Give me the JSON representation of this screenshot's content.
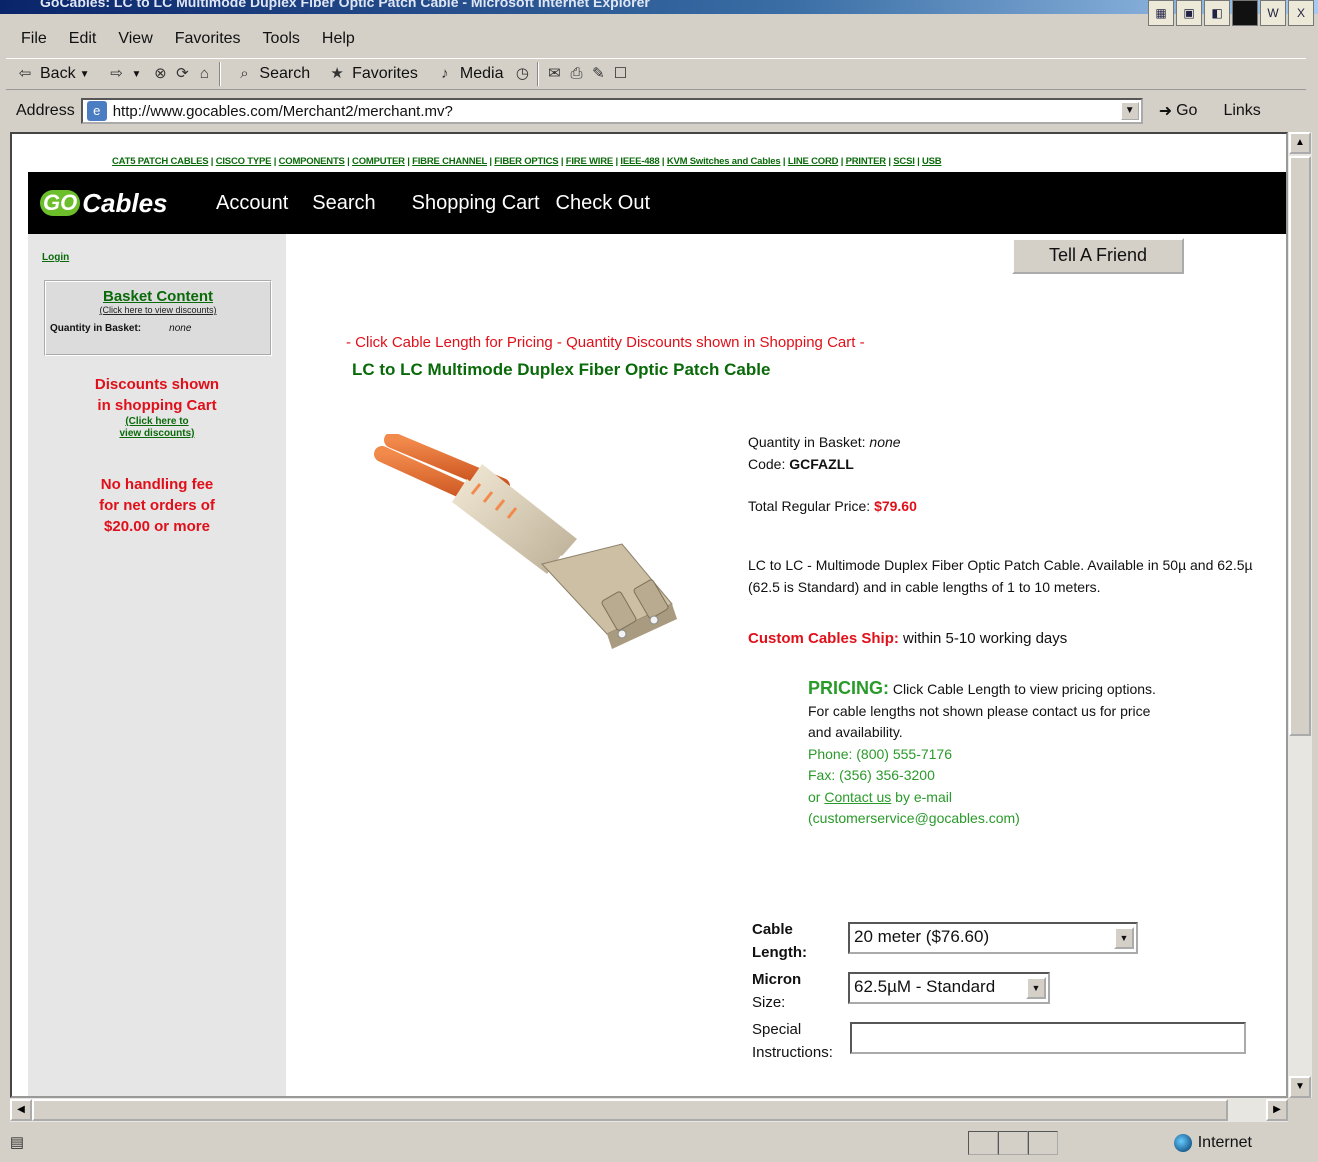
{
  "window": {
    "title": "GoCables: LC to LC Multimode Duplex Fiber Optic Patch Cable - Microsoft Internet Explorer"
  },
  "menu": [
    "File",
    "Edit",
    "View",
    "Favorites",
    "Tools",
    "Help"
  ],
  "toolbar": {
    "back": "Back",
    "search": "Search",
    "favorites": "Favorites",
    "media": "Media"
  },
  "address": {
    "label": "Address",
    "url": "http://www.gocables.com/Merchant2/merchant.mv?",
    "go": "Go",
    "links": "Links"
  },
  "status": {
    "zone": "Internet"
  },
  "site": {
    "categories": [
      "CAT5 PATCH CABLES",
      "CISCO TYPE",
      "COMPONENTS",
      "COMPUTER",
      "FIBRE CHANNEL",
      "FIBER OPTICS",
      "FIRE WIRE",
      "IEEE-488",
      "KVM Switches and Cables",
      "LINE CORD",
      "PRINTER",
      "SCSI",
      "USB"
    ],
    "logo": {
      "go": "GO",
      "rest": "Cables"
    },
    "nav": [
      "Account",
      "Search",
      "Shopping Cart",
      "Check Out"
    ]
  },
  "sidebar": {
    "login": "Login",
    "basket_title": "Basket Content",
    "basket_sub": "(Click here to view discounts)",
    "qty_label": "Quantity in Basket:",
    "qty_value": "none",
    "discount_line1": "Discounts shown",
    "discount_line2": "in shopping Cart",
    "discount_link1": "(Click here to",
    "discount_link2": "view discounts)",
    "fee_line1": "No handling fee",
    "fee_line2": "for net orders of",
    "fee_line3": "$20.00 or more"
  },
  "main": {
    "tell_friend": "Tell A Friend",
    "promo": "- Click Cable Length for Pricing - Quantity Discounts shown in Shopping Cart -",
    "title": "LC to LC Multimode Duplex Fiber Optic Patch Cable",
    "qty_label": "Quantity in Basket:",
    "qty_value": "none",
    "code_label": "Code:",
    "code_value": "GCFAZLL",
    "price_label": "Total Regular Price:",
    "price_value": "$79.60",
    "description": "LC to LC - Multimode Duplex Fiber Optic Patch Cable. Available in 50µ and 62.5µ (62.5 is Standard) and in cable lengths of 1 to 10 meters.",
    "ship_label": "Custom Cables Ship:",
    "ship_value": "within 5-10 working days",
    "pricing_head": "PRICING:",
    "pricing_text": "Click Cable Length to view pricing options. For cable lengths not shown please contact us for price and availability.",
    "phone": "Phone: (800) 555-7176",
    "fax": "Fax: (356) 356-3200",
    "contact_pre": "or ",
    "contact_link": "Contact us",
    "contact_post": " by e-mail",
    "email": "(customerservice@gocables.com)",
    "cable_length_label1": "Cable",
    "cable_length_label2": "Length:",
    "cable_length_value": "20 meter ($76.60)",
    "micron_label1": "Micron",
    "micron_label2": "Size:",
    "micron_value": "62.5µM - Standard",
    "special_label1": "Special",
    "special_label2": "Instructions:"
  }
}
